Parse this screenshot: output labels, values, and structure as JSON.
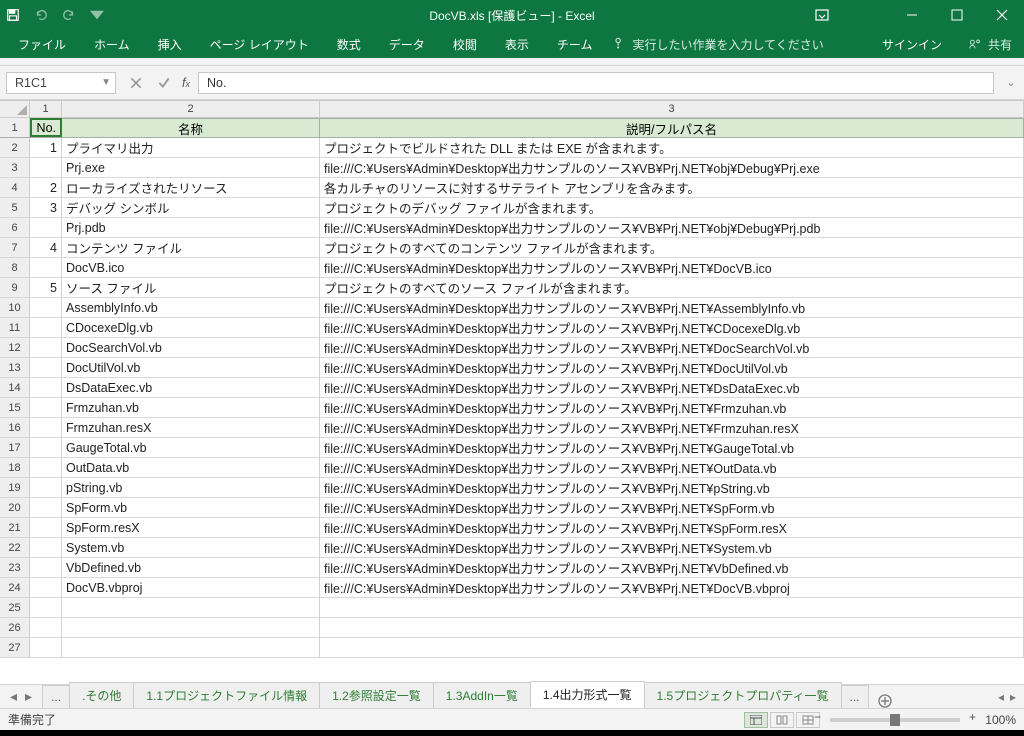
{
  "titlebar": {
    "title": "DocVB.xls  [保護ビュー] - Excel"
  },
  "ribbon": {
    "tabs": [
      "ファイル",
      "ホーム",
      "挿入",
      "ページ レイアウト",
      "数式",
      "データ",
      "校閲",
      "表示",
      "チーム"
    ],
    "tellme": "実行したい作業を入力してください",
    "signin": "サインイン",
    "share": "共有"
  },
  "formula": {
    "namebox": "R1C1",
    "value": "No."
  },
  "columns": [
    "1",
    "2",
    "3"
  ],
  "headerRow": {
    "row": "1",
    "c1": "No.",
    "c2": "名称",
    "c3": "説明/フルパス名"
  },
  "data": [
    {
      "row": "2",
      "no": "1",
      "name": "プライマリ出力",
      "desc": "プロジェクトでビルドされた DLL または EXE が含まれます。"
    },
    {
      "row": "3",
      "no": "",
      "name": "Prj.exe",
      "desc": "file:///C:¥Users¥Admin¥Desktop¥出力サンプルのソース¥VB¥Prj.NET¥obj¥Debug¥Prj.exe"
    },
    {
      "row": "4",
      "no": "2",
      "name": "ローカライズされたリソース",
      "desc": "各カルチャのリソースに対するサテライト アセンブリを含みます。"
    },
    {
      "row": "5",
      "no": "3",
      "name": "デバッグ シンボル",
      "desc": "プロジェクトのデバッグ ファイルが含まれます。"
    },
    {
      "row": "6",
      "no": "",
      "name": "Prj.pdb",
      "desc": "file:///C:¥Users¥Admin¥Desktop¥出力サンプルのソース¥VB¥Prj.NET¥obj¥Debug¥Prj.pdb"
    },
    {
      "row": "7",
      "no": "4",
      "name": "コンテンツ ファイル",
      "desc": "プロジェクトのすべてのコンテンツ ファイルが含まれます。"
    },
    {
      "row": "8",
      "no": "",
      "name": "DocVB.ico",
      "desc": "file:///C:¥Users¥Admin¥Desktop¥出力サンプルのソース¥VB¥Prj.NET¥DocVB.ico"
    },
    {
      "row": "9",
      "no": "5",
      "name": "ソース ファイル",
      "desc": "プロジェクトのすべてのソース ファイルが含まれます。"
    },
    {
      "row": "10",
      "no": "",
      "name": "AssemblyInfo.vb",
      "desc": "file:///C:¥Users¥Admin¥Desktop¥出力サンプルのソース¥VB¥Prj.NET¥AssemblyInfo.vb"
    },
    {
      "row": "11",
      "no": "",
      "name": "CDocexeDlg.vb",
      "desc": "file:///C:¥Users¥Admin¥Desktop¥出力サンプルのソース¥VB¥Prj.NET¥CDocexeDlg.vb"
    },
    {
      "row": "12",
      "no": "",
      "name": "DocSearchVol.vb",
      "desc": "file:///C:¥Users¥Admin¥Desktop¥出力サンプルのソース¥VB¥Prj.NET¥DocSearchVol.vb"
    },
    {
      "row": "13",
      "no": "",
      "name": "DocUtilVol.vb",
      "desc": "file:///C:¥Users¥Admin¥Desktop¥出力サンプルのソース¥VB¥Prj.NET¥DocUtilVol.vb"
    },
    {
      "row": "14",
      "no": "",
      "name": "DsDataExec.vb",
      "desc": "file:///C:¥Users¥Admin¥Desktop¥出力サンプルのソース¥VB¥Prj.NET¥DsDataExec.vb"
    },
    {
      "row": "15",
      "no": "",
      "name": "Frmzuhan.vb",
      "desc": "file:///C:¥Users¥Admin¥Desktop¥出力サンプルのソース¥VB¥Prj.NET¥Frmzuhan.vb"
    },
    {
      "row": "16",
      "no": "",
      "name": "Frmzuhan.resX",
      "desc": "file:///C:¥Users¥Admin¥Desktop¥出力サンプルのソース¥VB¥Prj.NET¥Frmzuhan.resX"
    },
    {
      "row": "17",
      "no": "",
      "name": "GaugeTotal.vb",
      "desc": "file:///C:¥Users¥Admin¥Desktop¥出力サンプルのソース¥VB¥Prj.NET¥GaugeTotal.vb"
    },
    {
      "row": "18",
      "no": "",
      "name": "OutData.vb",
      "desc": "file:///C:¥Users¥Admin¥Desktop¥出力サンプルのソース¥VB¥Prj.NET¥OutData.vb"
    },
    {
      "row": "19",
      "no": "",
      "name": "pString.vb",
      "desc": "file:///C:¥Users¥Admin¥Desktop¥出力サンプルのソース¥VB¥Prj.NET¥pString.vb"
    },
    {
      "row": "20",
      "no": "",
      "name": "SpForm.vb",
      "desc": "file:///C:¥Users¥Admin¥Desktop¥出力サンプルのソース¥VB¥Prj.NET¥SpForm.vb"
    },
    {
      "row": "21",
      "no": "",
      "name": "SpForm.resX",
      "desc": "file:///C:¥Users¥Admin¥Desktop¥出力サンプルのソース¥VB¥Prj.NET¥SpForm.resX"
    },
    {
      "row": "22",
      "no": "",
      "name": "System.vb",
      "desc": "file:///C:¥Users¥Admin¥Desktop¥出力サンプルのソース¥VB¥Prj.NET¥System.vb"
    },
    {
      "row": "23",
      "no": "",
      "name": "VbDefined.vb",
      "desc": "file:///C:¥Users¥Admin¥Desktop¥出力サンプルのソース¥VB¥Prj.NET¥VbDefined.vb"
    },
    {
      "row": "24",
      "no": "",
      "name": "DocVB.vbproj",
      "desc": "file:///C:¥Users¥Admin¥Desktop¥出力サンプルのソース¥VB¥Prj.NET¥DocVB.vbproj"
    },
    {
      "row": "25",
      "no": "",
      "name": "",
      "desc": ""
    },
    {
      "row": "26",
      "no": "",
      "name": "",
      "desc": ""
    },
    {
      "row": "27",
      "no": "",
      "name": "",
      "desc": ""
    }
  ],
  "sheetTabs": {
    "ellipsis": "...",
    "items": [
      ".その他",
      "1.1プロジェクトファイル情報",
      "1.2参照設定一覧",
      "1.3AddIn一覧",
      "1.4出力形式一覧",
      "1.5プロジェクトプロパティ一覧"
    ],
    "activeIndex": 4,
    "trailingEllipsis": "..."
  },
  "status": {
    "ready": "準備完了",
    "zoom": "100%"
  }
}
